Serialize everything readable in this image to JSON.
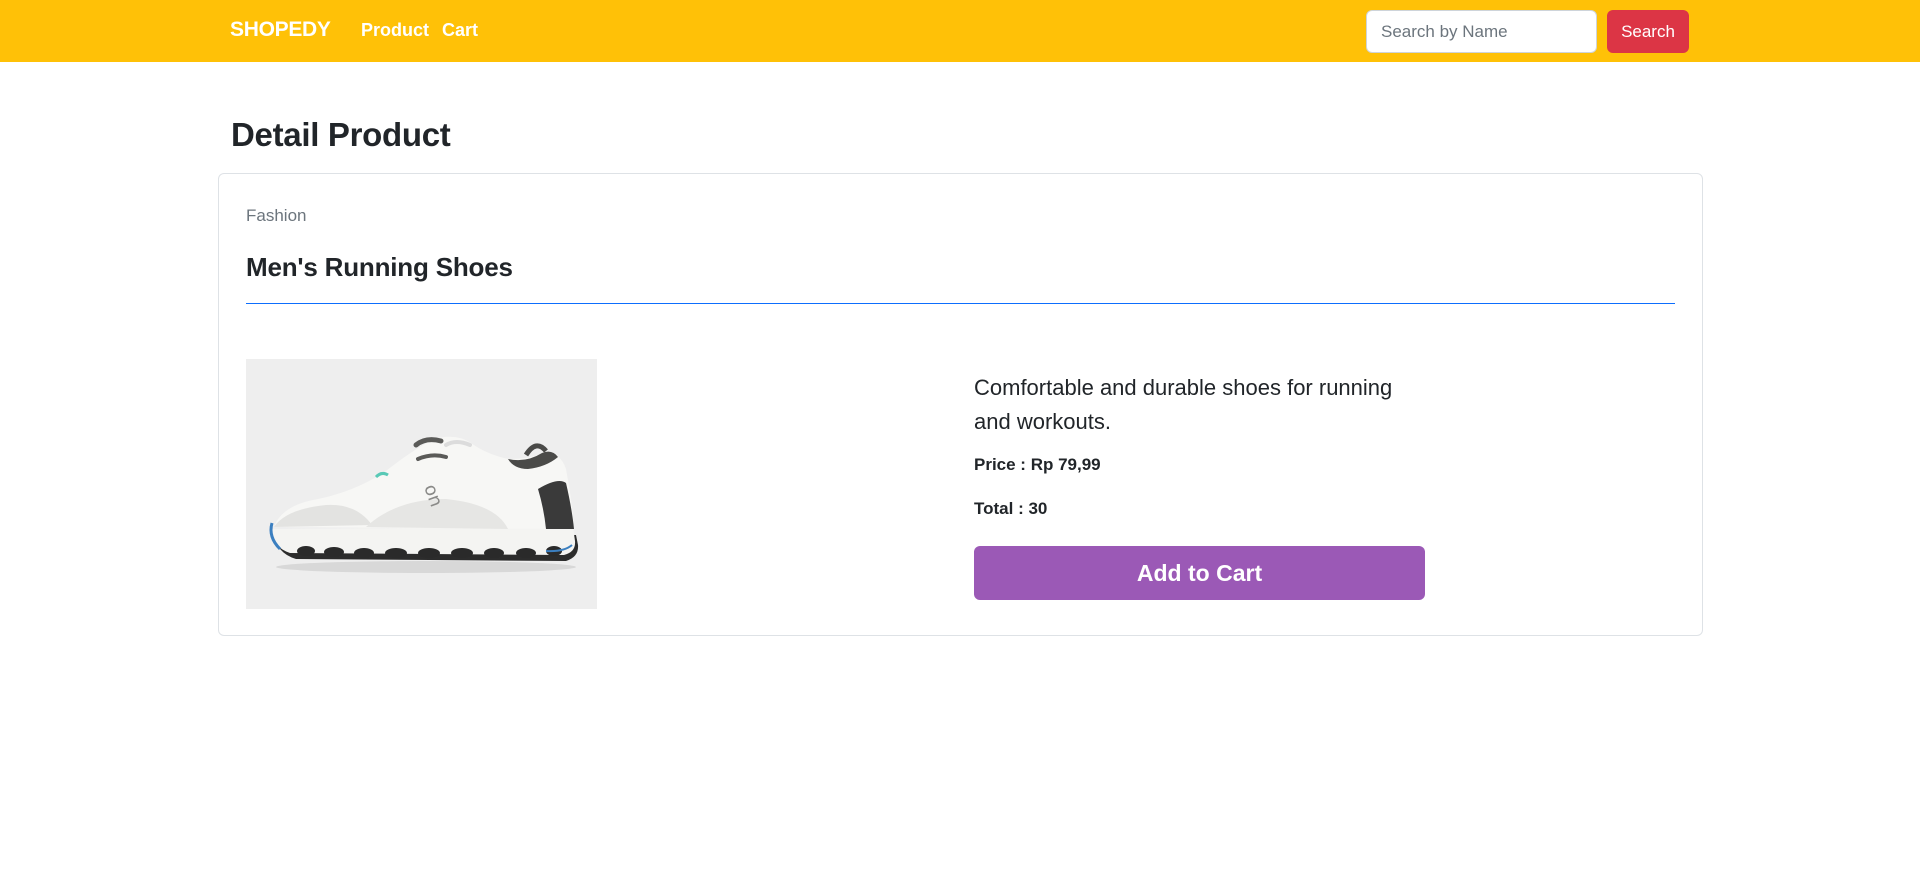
{
  "navbar": {
    "brand": "SHOPEDY",
    "links": [
      {
        "label": "Product"
      },
      {
        "label": "Cart"
      }
    ],
    "search": {
      "placeholder": "Search by Name",
      "value": "",
      "button_label": "Search"
    },
    "background_color": "#ffc107",
    "search_button_color": "#dc3545"
  },
  "page": {
    "title": "Detail Product"
  },
  "product": {
    "category": "Fashion",
    "name": "Men's Running Shoes",
    "image_icon": "running-shoe-image",
    "description": "Comfortable and durable shoes for running and workouts.",
    "price_text": "Price : Rp 79,99",
    "total_text": "Total : 30",
    "add_to_cart_label": "Add to Cart",
    "add_to_cart_color": "#9b59b6"
  }
}
